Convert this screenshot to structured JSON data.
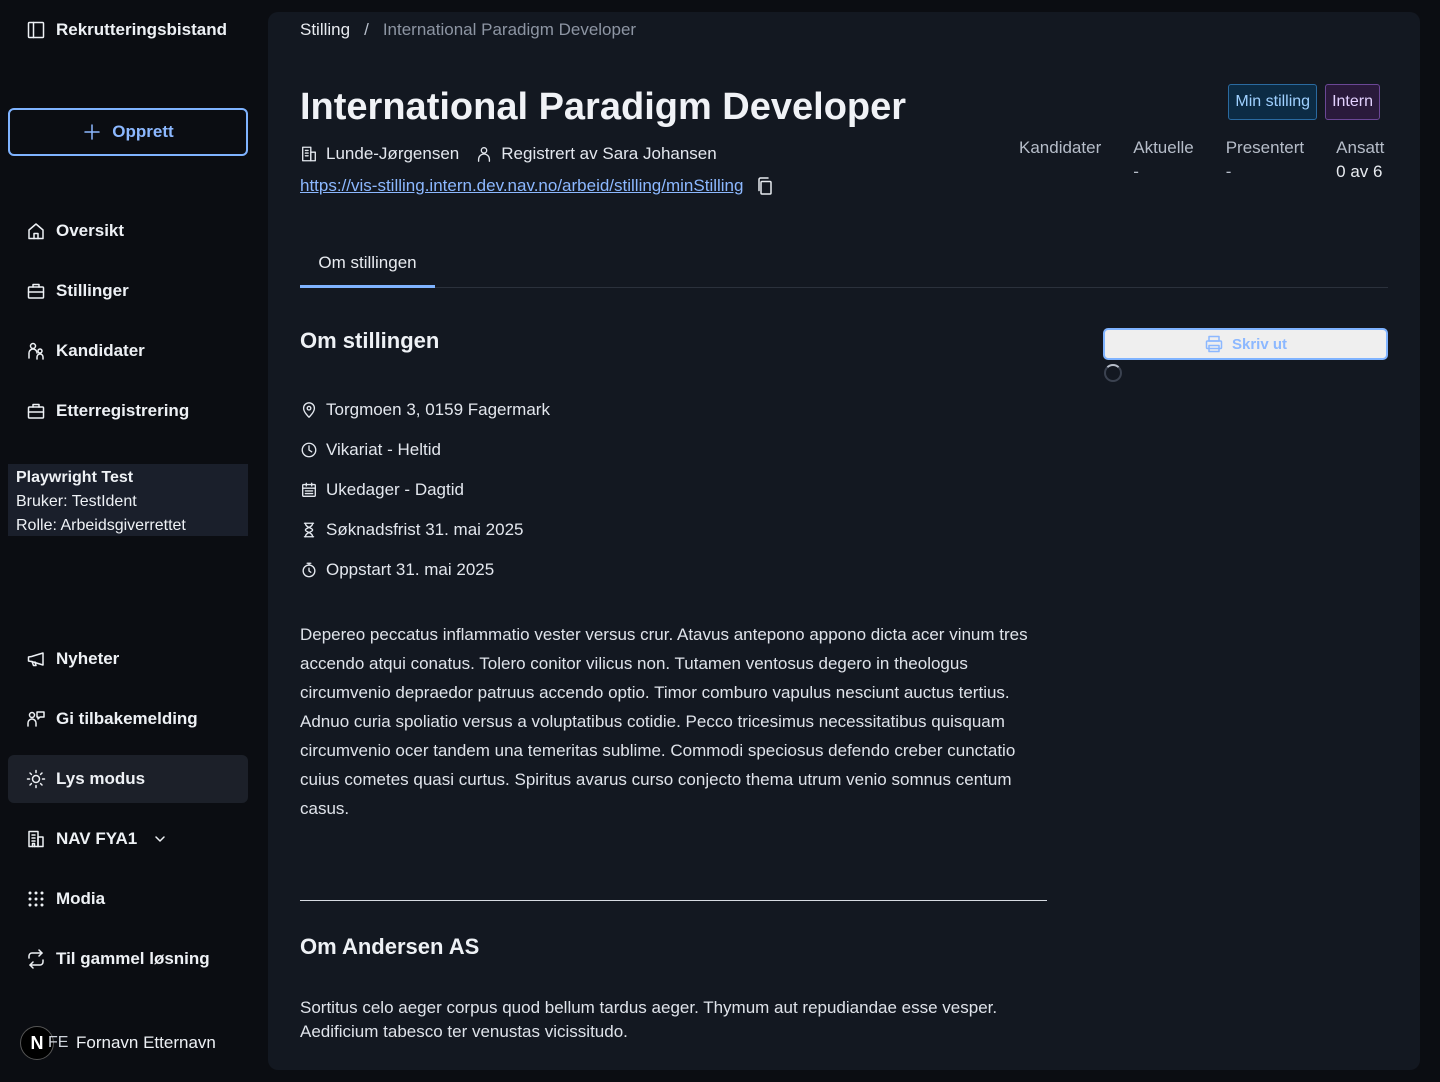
{
  "app": {
    "title": "Rekrutteringsbistand"
  },
  "sidebar": {
    "create_label": "Opprett",
    "nav_top": [
      {
        "label": "Oversikt",
        "icon": "house-icon"
      },
      {
        "label": "Stillinger",
        "icon": "briefcase-icon"
      },
      {
        "label": "Kandidater",
        "icon": "persons-icon"
      },
      {
        "label": "Etterregistrering",
        "icon": "briefcase-icon"
      }
    ],
    "user_info": {
      "title": "Playwright Test",
      "user_line": "Bruker: TestIdent",
      "role_line": "Rolle: Arbeidsgiverrettet"
    },
    "nav_bottom": [
      {
        "label": "Nyheter",
        "icon": "megaphone-icon"
      },
      {
        "label": "Gi tilbakemelding",
        "icon": "feedback-icon"
      },
      {
        "label": "Lys modus",
        "icon": "sun-icon",
        "active": true
      },
      {
        "label": "NAV FYA1",
        "icon": "building-icon"
      },
      {
        "label": "Modia",
        "icon": "grid-icon"
      },
      {
        "label": "Til gammel løsning",
        "icon": "arrows-icon"
      }
    ],
    "profile": {
      "badge": "N",
      "initials": "FE",
      "name": "Fornavn Etternavn"
    }
  },
  "breadcrumb": {
    "parent": "Stilling",
    "separator": "/",
    "current": "International Paradigm Developer"
  },
  "job": {
    "title": "International Paradigm Developer",
    "employer": "Lunde-Jørgensen",
    "registered_by": "Registrert av Sara Johansen",
    "url": "https://vis-stilling.intern.dev.nav.no/arbeid/stilling/minStilling",
    "tags": [
      {
        "label": "Min stilling",
        "color": "#0c2b44"
      },
      {
        "label": "Intern",
        "color": "#2a1a3b"
      }
    ],
    "stats": [
      {
        "label": "Kandidater",
        "value": ""
      },
      {
        "label": "Aktuelle",
        "value": "-"
      },
      {
        "label": "Presentert",
        "value": "-"
      },
      {
        "label": "Ansatt",
        "value": "0 av 6"
      }
    ]
  },
  "tabs": [
    {
      "label": "Om stillingen",
      "active": true
    }
  ],
  "details": {
    "section_title": "Om stillingen",
    "print_label": "Skriv ut",
    "facts": [
      {
        "icon": "location-pin-icon",
        "text": "Torgmoen 3, 0159 Fagermark"
      },
      {
        "icon": "clock-icon",
        "text": "Vikariat - Heltid"
      },
      {
        "icon": "calendar-icon",
        "text": "Ukedager - Dagtid"
      },
      {
        "icon": "hourglass-icon",
        "text": "Søknadsfrist 31. mai 2025"
      },
      {
        "icon": "stopwatch-icon",
        "text": "Oppstart 31. mai 2025"
      }
    ],
    "description": "Depereo peccatus inflammatio vester versus crur. Atavus antepono appono dicta acer vinum tres accendo atqui conatus. Tolero conitor vilicus non. Tutamen ventosus degero in theologus circumvenio depraedor patruus accendo optio. Timor comburo vapulus nesciunt auctus tertius. Adnuo curia spoliatio versus a voluptatibus cotidie. Pecco tricesimus necessitatibus quisquam circumvenio ocer tandem una temeritas sublime. Commodi speciosus defendo creber cunctatio cuius cometes quasi curtus. Spiritus avarus curso conjecto thema utrum venio somnus centum casus.",
    "employer_section_title": "Om Andersen AS",
    "employer_description": "Sortitus celo aeger corpus quod bellum tardus aeger. Thymum aut repudiandae esse vesper. Aedificium tabesco ter venustas vicissitudo."
  },
  "colors": {
    "accent": "#7fb3ff",
    "panel": "#131821",
    "background": "#0b0d12"
  }
}
